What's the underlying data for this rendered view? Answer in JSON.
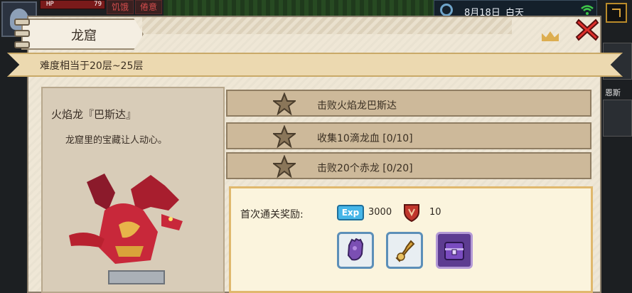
{
  "hud": {
    "hp_label": "HP",
    "hp_value": "79",
    "status_chips": [
      "饥饿",
      "倦意"
    ],
    "date": "8月18日",
    "time_of_day": "白天",
    "side_label": "恩斯"
  },
  "dialog": {
    "title": "龙窟",
    "difficulty": "难度相当于20层~25层",
    "close_icon": "close-x-icon"
  },
  "boss": {
    "name": "火焰龙『巴斯达』",
    "description": "龙窟里的宝藏让人动心。"
  },
  "quests": [
    {
      "label": "击败火焰龙巴斯达"
    },
    {
      "label": "收集10滴龙血 [0/10]"
    },
    {
      "label": "击败20个赤龙 [0/20]"
    }
  ],
  "reward": {
    "label": "首次通关奖励:",
    "exp_badge": "Exp",
    "exp_value": "3000",
    "shield_value": "10",
    "items": [
      "purple-glove-icon",
      "golden-horn-icon",
      "purple-chest-icon"
    ]
  },
  "colors": {
    "panel": "#efe7d6",
    "quest": "#cdb99a",
    "ribbon": "#ecd9b0",
    "close_red": "#e0302c",
    "exp_blue": "#46b6e8"
  }
}
